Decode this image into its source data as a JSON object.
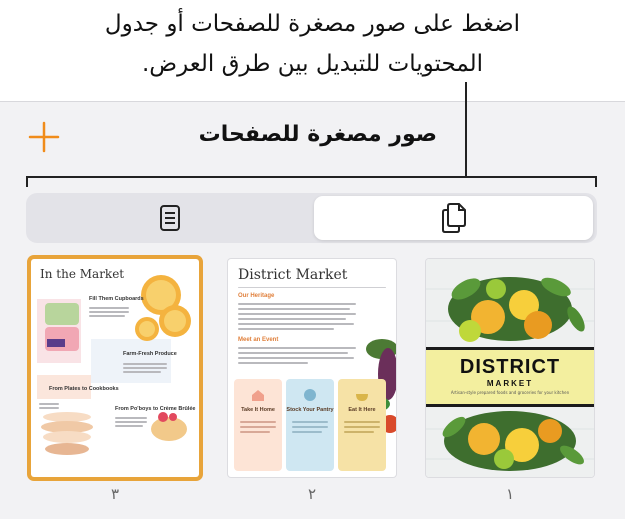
{
  "callout": {
    "line1": "اضغط على صور مصغرة للصفحات أو جدول",
    "line2": "المحتويات للتبديل بين طرق العرض."
  },
  "panel": {
    "title": "صور مصغرة للصفحات",
    "add_icon": "plus-icon",
    "view_control": {
      "options": [
        {
          "name": "table-of-contents",
          "icon": "table-of-contents-icon"
        },
        {
          "name": "page-thumbnails",
          "icon": "page-thumbnails-icon",
          "selected": true
        }
      ]
    },
    "accent_color": "#f08c1a"
  },
  "pages": [
    {
      "number": "١",
      "cover_title": "DISTRICT",
      "cover_subtitle": "MARKET",
      "cover_tagline": "Artisan-style prepared foods and groceries for your kitchen"
    },
    {
      "number": "٢",
      "title": "District Market",
      "section1": "Our Heritage",
      "section2": "Meet an Event",
      "cards": [
        "Take It Home",
        "Stock Your Pantry",
        "Eat It Here"
      ]
    },
    {
      "number": "٣",
      "selected": true,
      "selection_color": "#e8a43a",
      "title": "In the Market",
      "headings": [
        "Fill Them Cupboards",
        "Farm-Fresh Produce",
        "From Plates to Cookbooks",
        "From Po'boys to Crème Brûlée"
      ]
    }
  ]
}
